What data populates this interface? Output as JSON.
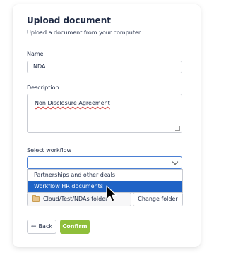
{
  "header": {
    "title": "Upload document",
    "subtitle": "Upload a document from your computer"
  },
  "fields": {
    "name_label": "Name",
    "name_value": "NDA",
    "description_label": "Description",
    "description_value": "Non Disclosure Agreement",
    "workflow_label": "Select workflow",
    "workflow_value": ""
  },
  "dropdown": {
    "options": [
      "Partnerships and other deals",
      "Workflow HR documents"
    ],
    "highlighted_index": 1
  },
  "folder": {
    "path": "Cloud/Test/NDAs folder",
    "change_label": "Change folder"
  },
  "actions": {
    "back_label": "Back",
    "confirm_label": "Confirm"
  },
  "colors": {
    "accent": "#1f63c6",
    "confirm": "#8fbf3a"
  },
  "icons": {
    "back": "arrow-left-icon",
    "folder": "folder-icon",
    "chevron": "chevron-down-icon",
    "cursor": "mouse-pointer-icon"
  }
}
